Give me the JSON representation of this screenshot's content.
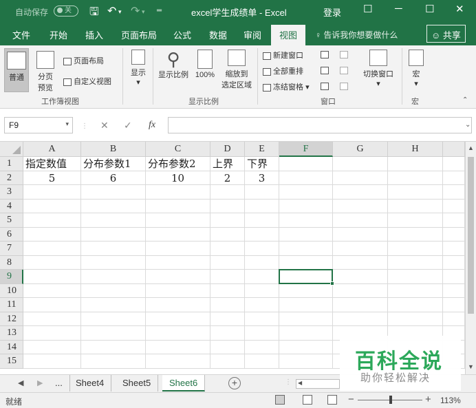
{
  "titlebar": {
    "autosave_label": "自动保存",
    "autosave_state": "关",
    "title": "excel学生成绩单  -  Excel",
    "login_label": "登录"
  },
  "tabs": [
    {
      "label": "文件"
    },
    {
      "label": "开始"
    },
    {
      "label": "插入"
    },
    {
      "label": "页面布局"
    },
    {
      "label": "公式"
    },
    {
      "label": "数据"
    },
    {
      "label": "审阅"
    },
    {
      "label": "视图"
    }
  ],
  "tell_me": "告诉我你想要做什么",
  "share_label": "共享",
  "ribbon": {
    "workbook_views": {
      "normal": "普通",
      "page_break_line1": "分页",
      "page_break_line2": "预览",
      "page_layout": "页面布局",
      "custom_views": "自定义视图",
      "group": "工作簿视图"
    },
    "show": {
      "label": "显示"
    },
    "zoom": {
      "zoom": "显示比例",
      "hundred": "100%",
      "zoom_sel_line1": "缩放到",
      "zoom_sel_line2": "选定区域",
      "group": "显示比例"
    },
    "window": {
      "new_window": "新建窗口",
      "arrange_all": "全部重排",
      "freeze_panes": "冻结窗格",
      "switch_windows": "切换窗口",
      "group": "窗口"
    },
    "macros": {
      "label": "宏",
      "group": "宏"
    }
  },
  "formula_bar": {
    "name_box": "F9",
    "fx_label": "fx",
    "formula_value": ""
  },
  "columns": [
    "A",
    "B",
    "C",
    "D",
    "E",
    "F",
    "G",
    "H"
  ],
  "rows": [
    "1",
    "2",
    "3",
    "4",
    "5",
    "6",
    "7",
    "8",
    "9",
    "10",
    "11",
    "12",
    "13",
    "14",
    "15"
  ],
  "cells": {
    "A1": "指定数值",
    "B1": "分布参数1",
    "C1": "分布参数2",
    "D1": "上界",
    "E1": "下界",
    "A2": "5",
    "B2": "6",
    "C2": "10",
    "D2": "2",
    "E2": "3"
  },
  "active_cell": "F9",
  "sheets": {
    "ellipsis": "...",
    "tabs": [
      "Sheet4",
      "Sheet5",
      "Sheet6"
    ],
    "active": "Sheet6"
  },
  "status": {
    "ready": "就绪",
    "zoom_level": "113%",
    "zoom_percent": 113
  },
  "watermark": {
    "main": "百科全说",
    "sub": "助你轻松解决"
  },
  "colors": {
    "accent": "#217346",
    "watermark_green": "#2ca85a"
  }
}
